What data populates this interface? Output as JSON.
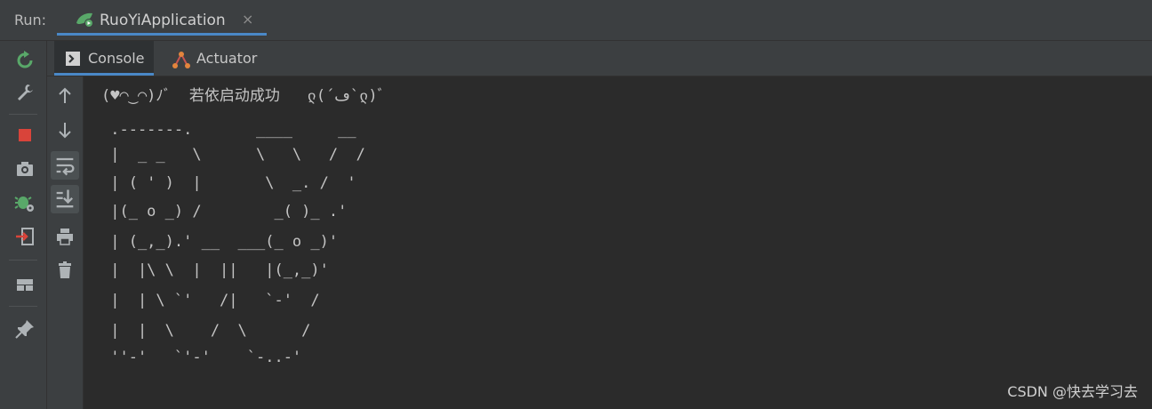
{
  "run_bar": {
    "label": "Run:",
    "tab_title": "RuoYiApplication",
    "close_glyph": "×"
  },
  "subtabs": [
    {
      "label": "Console",
      "icon": "console-icon"
    },
    {
      "label": "Actuator",
      "icon": "actuator-icon"
    }
  ],
  "left_tools": [
    "rerun-icon",
    "wrench-icon",
    "stop-icon",
    "camera-icon",
    "bug-settings-icon",
    "exit-icon",
    "layout-icon",
    "pin-icon"
  ],
  "console_tools": [
    "up-arrow-icon",
    "down-arrow-icon",
    "soft-wrap-icon",
    "scroll-to-end-icon",
    "print-icon",
    "trash-icon"
  ],
  "console": {
    "lines": [
      "(♥◠‿◠)ﾉﾞ  若依启动成功   ლ(´ڡ`ლ)ﾞ",
      " .-------.       ____     __",
      " |  _ _   \\      \\   \\   /  /",
      " | ( ' )  |       \\  _. /  '",
      " |(_ o _) /        _( )_ .'",
      " | (_,_).' __  ___(_ o _)'",
      " |  |\\ \\  |  ||   |(_,_)'",
      " |  | \\ `'   /|   `-'  /",
      " |  |  \\    /  \\      /",
      " ''-'   `'-'    `-..-'"
    ]
  },
  "watermark": "CSDN @快去学习去",
  "colors": {
    "background": "#2b2b2b",
    "panel": "#3c3f41",
    "accent": "#4a88c7",
    "text": "#c4c4c4",
    "stop": "#d9443a",
    "run_green": "#59a869"
  }
}
